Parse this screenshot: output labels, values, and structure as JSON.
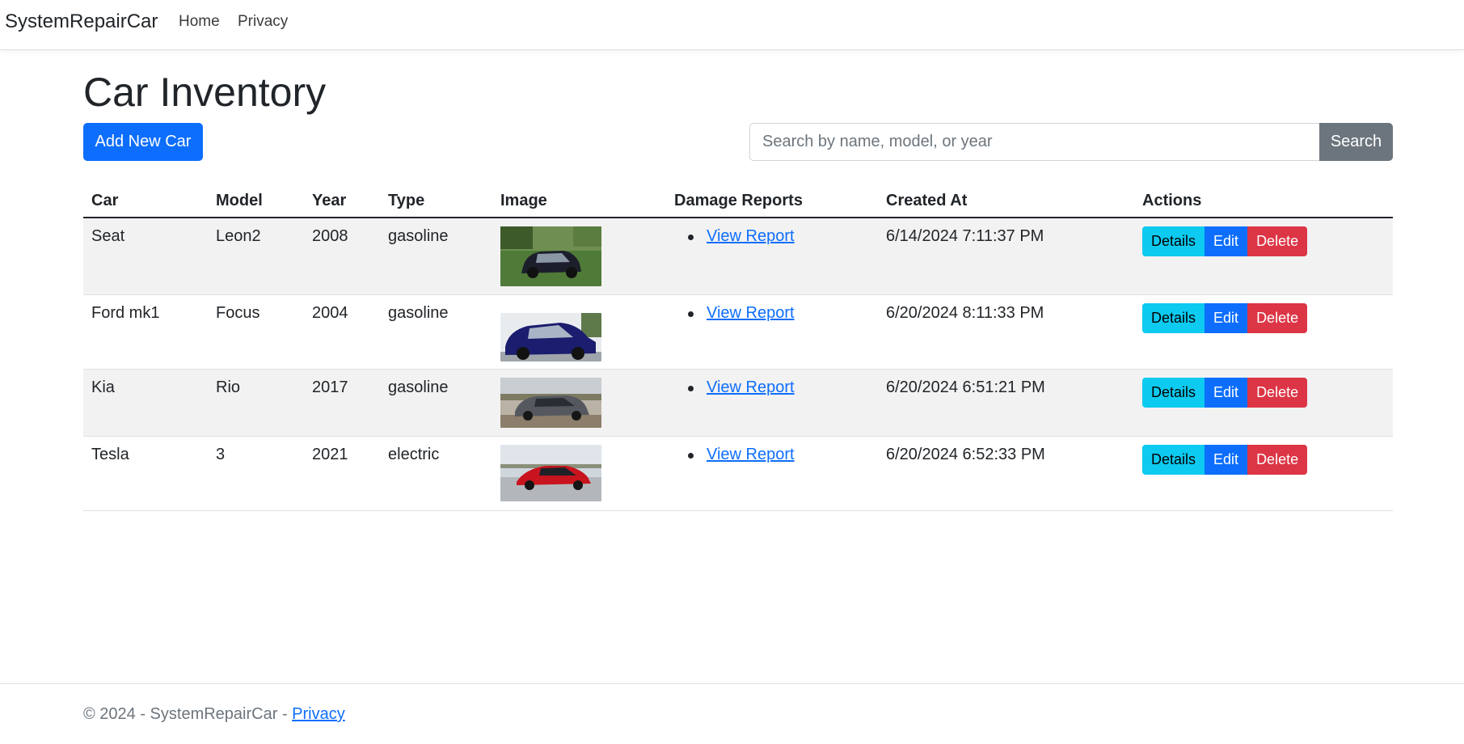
{
  "navbar": {
    "brand": "SystemRepairCar",
    "links": [
      "Home",
      "Privacy"
    ]
  },
  "page": {
    "title": "Car Inventory",
    "add_button": "Add New Car",
    "search_placeholder": "Search by name, model, or year",
    "search_button": "Search"
  },
  "table": {
    "headers": [
      "Car",
      "Model",
      "Year",
      "Type",
      "Image",
      "Damage Reports",
      "Created At",
      "Actions"
    ],
    "rows": [
      {
        "car": "Seat",
        "model": "Leon2",
        "year": "2008",
        "type": "gasoline",
        "image": "car-photo-dark-hatchback",
        "report": "View Report",
        "created": "6/14/2024 7:11:37 PM"
      },
      {
        "car": "Ford mk1",
        "model": "Focus",
        "year": "2004",
        "type": "gasoline",
        "image": "car-photo-blue-hatchback",
        "report": "View Report",
        "created": "6/20/2024 8:11:33 PM"
      },
      {
        "car": "Kia",
        "model": "Rio",
        "year": "2017",
        "type": "gasoline",
        "image": "car-photo-grey-hatchback",
        "report": "View Report",
        "created": "6/20/2024 6:51:21 PM"
      },
      {
        "car": "Tesla",
        "model": "3",
        "year": "2021",
        "type": "electric",
        "image": "car-photo-red-sedan",
        "report": "View Report",
        "created": "6/20/2024 6:52:33 PM"
      }
    ],
    "action_labels": {
      "details": "Details",
      "edit": "Edit",
      "delete": "Delete"
    }
  },
  "footer": {
    "text": "© 2024 - SystemRepairCar - ",
    "link": "Privacy"
  },
  "colors": {
    "primary": "#0d6efd",
    "info": "#0dcaf0",
    "danger": "#dc3545",
    "secondary": "#6c757d"
  }
}
